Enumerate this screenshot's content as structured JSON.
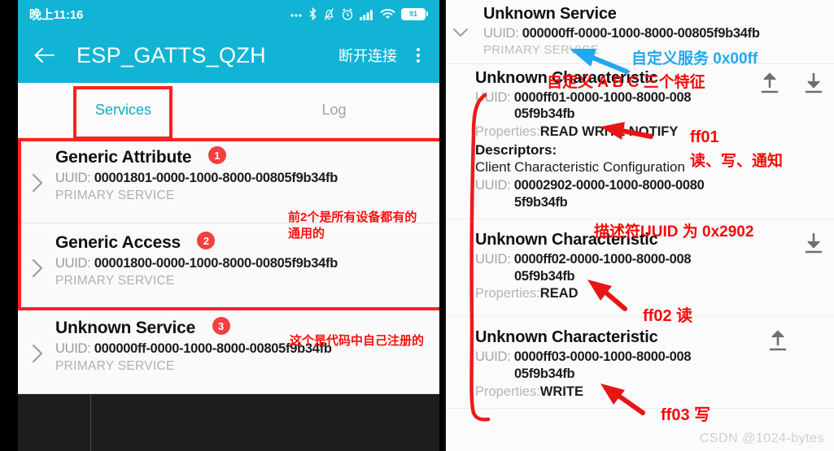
{
  "phone": {
    "status_bar": {
      "clock": "晚上11:16",
      "battery_level": "91",
      "icons": [
        "more-dots-icon",
        "bluetooth-icon",
        "bell-muted-icon",
        "alarm-icon",
        "signal-bars-icon",
        "wifi-icon",
        "battery-icon"
      ]
    },
    "app_bar": {
      "back_icon": "back-arrow-icon",
      "title": "ESP_GATTS_QZH",
      "action_label": "断开连接",
      "overflow_icon": "kebab-menu-icon"
    },
    "tabs": [
      {
        "label": "Services",
        "active": true
      },
      {
        "label": "Log",
        "active": false
      }
    ],
    "services": [
      {
        "name": "Generic Attribute",
        "badge": "1",
        "uuid_label": "UUID:",
        "uuid": "00001801-0000-1000-8000-00805f9b34fb",
        "type": "PRIMARY SERVICE"
      },
      {
        "name": "Generic Access",
        "badge": "2",
        "uuid_label": "UUID:",
        "uuid": "00001800-0000-1000-8000-00805f9b34fb",
        "type": "PRIMARY SERVICE"
      },
      {
        "name": "Unknown Service",
        "badge": "3",
        "uuid_label": "UUID:",
        "uuid": "000000ff-0000-1000-8000-00805f9b34fb",
        "type": "PRIMARY SERVICE"
      }
    ],
    "annotations": {
      "note_generic": "前2个是所有设备都有的\n通用的",
      "note_custom": "这个是代码中自己注册的"
    }
  },
  "detail": {
    "service": {
      "name": "Unknown Service",
      "uuid_label": "UUID:",
      "uuid": "000000ff-0000-1000-8000-00805f9b34fb",
      "type": "PRIMARY SERVICE"
    },
    "characteristics": [
      {
        "name": "Unknown Characteristic",
        "uuid_label": "UUID:",
        "uuid_line1": "0000ff01-0000-1000-8000-008",
        "uuid_line2": "05f9b34fb",
        "props_label": "Properties:",
        "props": "READ WRITE NOTIFY",
        "descriptors_label": "Descriptors:",
        "descriptor_name": "Client Characteristic Configuration",
        "descriptor_uuid_label": "UUID:",
        "descriptor_uuid_line1": "00002902-0000-1000-8000-0080",
        "descriptor_uuid_line2": "5f9b34fb",
        "icons": [
          "upload-icon",
          "download-icon"
        ]
      },
      {
        "name": "Unknown Characteristic",
        "uuid_label": "UUID:",
        "uuid_line1": "0000ff02-0000-1000-8000-008",
        "uuid_line2": "05f9b34fb",
        "props_label": "Properties:",
        "props": "READ",
        "icons": [
          "download-icon"
        ]
      },
      {
        "name": "Unknown Characteristic",
        "uuid_label": "UUID:",
        "uuid_line1": "0000ff03-0000-1000-8000-008",
        "uuid_line2": "05f9b34fb",
        "props_label": "Properties:",
        "props": "WRITE",
        "icons": [
          "upload-icon"
        ]
      }
    ],
    "annotations": {
      "custom_service": "自定义服务  0x00ff",
      "three_chars": "自定义  A  B  C  三个特征",
      "ff01": "ff01",
      "ff01_cn": "读、写、通知",
      "descriptor_uuid_note": "描述符UUID 为 0x2902",
      "ff02": "ff02 读",
      "ff03": "ff03 写"
    },
    "watermark": "CSDN @1024-bytes"
  },
  "colors": {
    "appbar": "#11b4d4",
    "tab_active": "#11a9cb",
    "badge": "#f43f3f",
    "annotation_red": "#fc1010",
    "annotation_blue": "#22a8ef"
  }
}
